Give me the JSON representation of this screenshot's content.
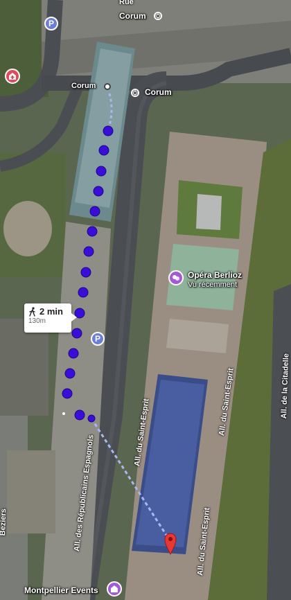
{
  "map": {
    "streets": {
      "top": "Rue",
      "republicains": "All. des Républicains Espagnols",
      "saint_esprit_1": "All. du Saint-Esprit",
      "saint_esprit_2": "All. du Saint-Esprit",
      "saint_esprit_3": "All. du Saint-Esprit",
      "citadelle": "All. de la Citadelle",
      "left_edge": "Beziers"
    },
    "places": {
      "corum_top": "Corum",
      "corum_stop": "Corum",
      "corum_station": "Corum",
      "opera_title": "Opéra Berlioz",
      "opera_sub": "Vu récemment",
      "events": "Montpellier Events"
    },
    "icons": {
      "parking_symbol": "P",
      "metro_symbol": "Ⓜ"
    },
    "walk": {
      "duration": "2 min",
      "distance": "130m"
    },
    "colors": {
      "route_dots": "#3a0dd9",
      "route_dashed": "#aab8f2",
      "destination_pin": "#e53935",
      "parking": "#6b7fd7",
      "poi": "#a35ad6"
    }
  }
}
